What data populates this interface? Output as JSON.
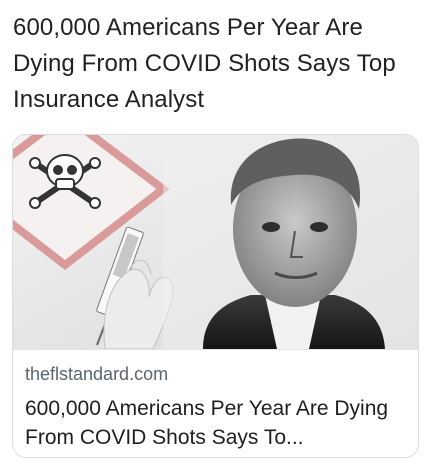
{
  "post": {
    "text": "600,000 Americans Per Year Are Dying From COVID Shots Says Top Insurance Analyst"
  },
  "card": {
    "domain": "theflstandard.com",
    "title": "600,000 Americans Per Year Are Dying From COVID Shots Says To..."
  },
  "colors": {
    "hazard_border": "#d99a9a",
    "card_border": "#d9dde1",
    "domain_text": "#5b6570"
  }
}
